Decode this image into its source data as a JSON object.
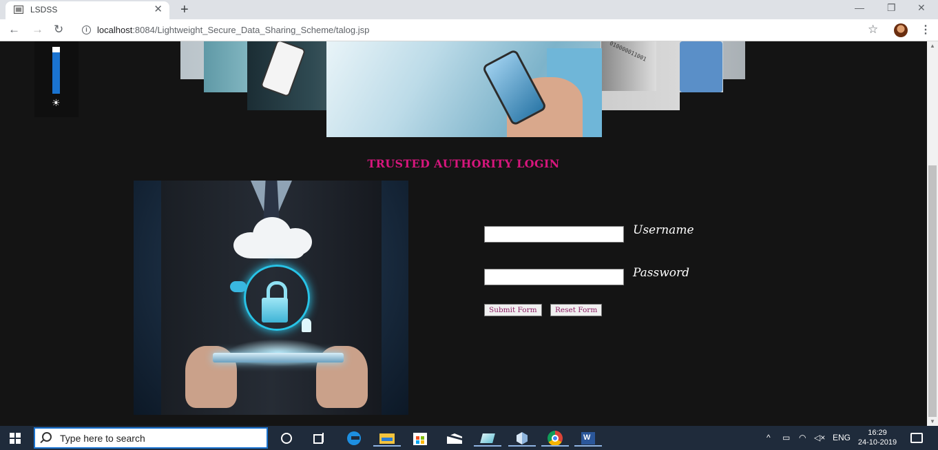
{
  "browser": {
    "tab_title": "LSDSS",
    "tab_close": "✕",
    "new_tab": "+",
    "url_host": "localhost",
    "url_rest": ":8084/Lightweight_Secure_Data_Sharing_Scheme/talog.jsp",
    "back": "←",
    "forward": "→",
    "reload": "↻",
    "star": "☆",
    "menu": "⋮",
    "minimize": "—",
    "restore": "❐",
    "close": "✕"
  },
  "brightness": {
    "level": 0.88,
    "icon": "sun-icon"
  },
  "banner": {
    "binary_text": "010000011001"
  },
  "page": {
    "title": "TRUSTED AUTHORITY LOGIN"
  },
  "form": {
    "username": {
      "label": "Username",
      "value": ""
    },
    "password": {
      "label": "Password",
      "value": ""
    },
    "submit_label": "Submit Form",
    "reset_label": "Reset Form"
  },
  "taskbar": {
    "search_placeholder": "Type here to search",
    "tray_language": "ENG",
    "time": "16:29",
    "date": "24-10-2019",
    "apps": [
      "cortana-icon",
      "task-view-icon",
      "edge-icon",
      "file-explorer-icon",
      "store-icon",
      "mail-icon",
      "app-icon",
      "box-app-icon",
      "chrome-icon",
      "word-icon"
    ]
  },
  "colors": {
    "accent_title": "#d6167d",
    "button_text": "#8b1c62",
    "taskbar": "#1f2b3b"
  }
}
